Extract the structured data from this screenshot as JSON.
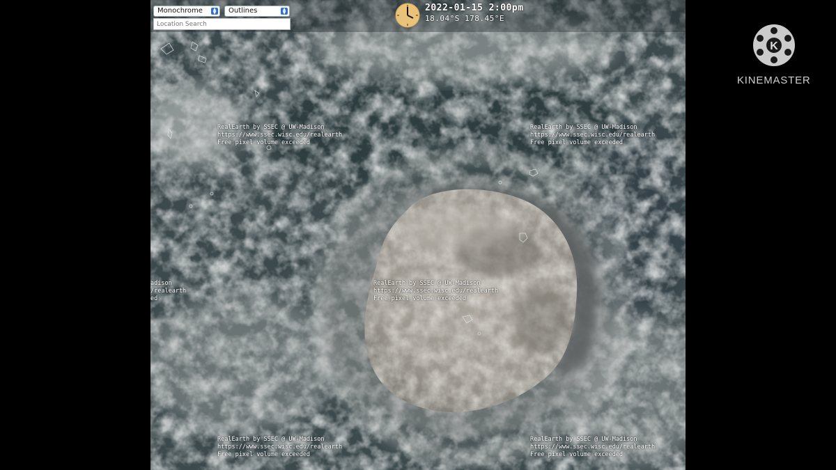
{
  "controls": {
    "basemap_select": "Monochrome",
    "overlay_select": "Outlines",
    "search_placeholder": "Location Search"
  },
  "timestamp": {
    "datetime": "2022-01-15 2:00pm",
    "coords": "18.04°S 178.45°E"
  },
  "watermark": {
    "line1": "RealEarth by SSEC @ UW-Madison",
    "line2": "https://www.ssec.wisc.edu/realearth",
    "line3": "Free pixel volume exceeded"
  },
  "watermark_partial": {
    "line1": "adison",
    "line2": "/realearth",
    "line3": "ed"
  },
  "branding": {
    "name": "KINEMASTER",
    "icon": "kinemaster-logo-icon"
  },
  "colors": {
    "background": "#000000",
    "ocean": "#3a474a",
    "cloud": "#c9ccca",
    "plume": "#9e9b94",
    "clock_face": "#e9c37a",
    "select_arrow": "#2f6fd6"
  }
}
